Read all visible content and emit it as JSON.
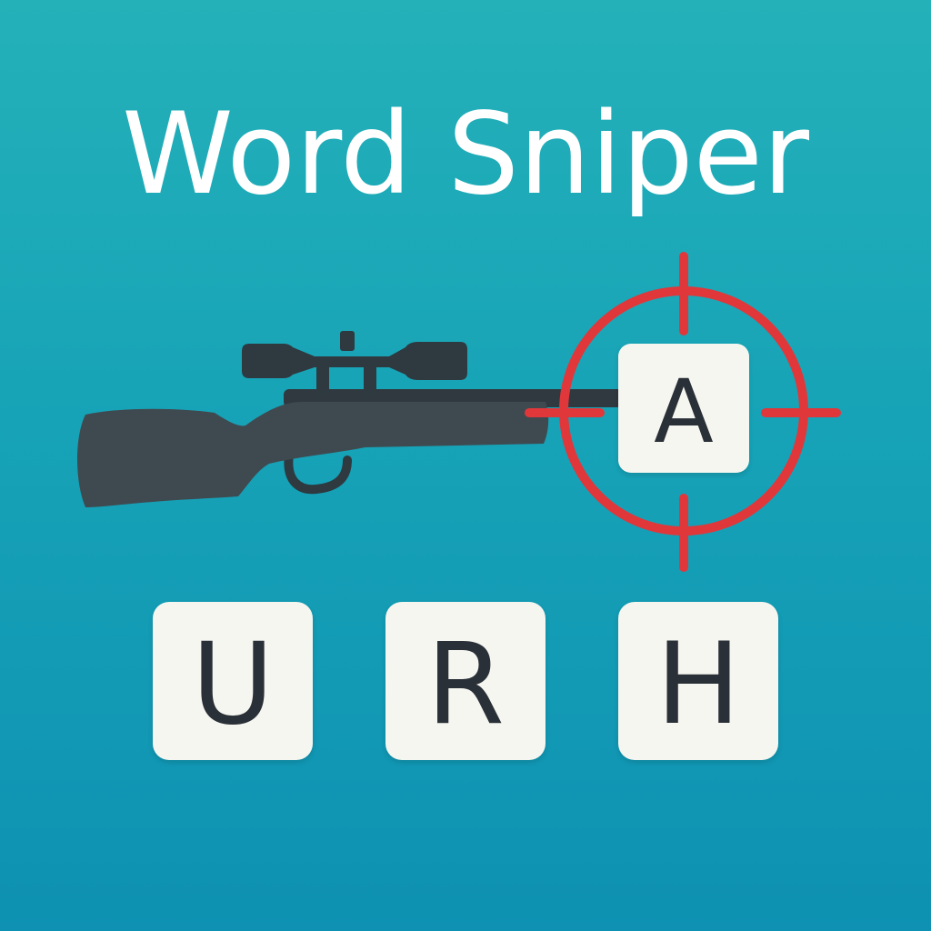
{
  "game": {
    "title": "Word Sniper"
  },
  "target_letter": {
    "letter": "A"
  },
  "letter_tiles": [
    {
      "letter": "U"
    },
    {
      "letter": "R"
    },
    {
      "letter": "H"
    }
  ],
  "colors": {
    "background_top": "#24b1b8",
    "background_bottom": "#0e91b2",
    "rifle": "#3f4a50",
    "scope": "#2f3940",
    "crosshair": "#e0373b",
    "tile": "#f6f6f0",
    "tile_text": "#2a3037",
    "title_text": "#ffffff"
  },
  "icons": {
    "rifle": "sniper-rifle-icon",
    "crosshair": "crosshair-icon"
  }
}
